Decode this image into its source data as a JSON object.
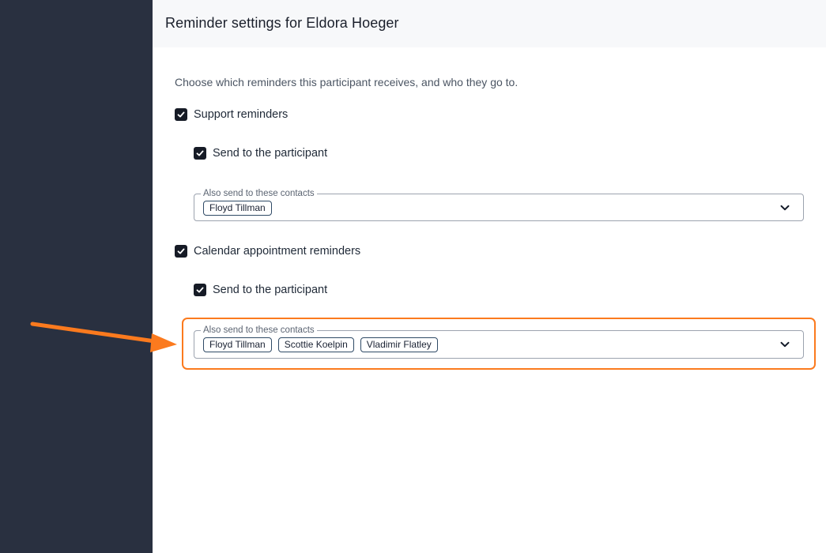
{
  "header": {
    "title": "Reminder settings for Eldora Hoeger"
  },
  "intro": "Choose which reminders this participant receives, and who they go to.",
  "sections": [
    {
      "label": "Support reminders",
      "checked": true,
      "send_to_participant": {
        "label": "Send to the participant",
        "checked": true
      },
      "contacts_field": {
        "legend": "Also send to these contacts",
        "chips": [
          "Floyd Tillman"
        ]
      }
    },
    {
      "label": "Calendar appointment reminders",
      "checked": true,
      "send_to_participant": {
        "label": "Send to the participant",
        "checked": true
      },
      "contacts_field": {
        "legend": "Also send to these contacts",
        "chips": [
          "Floyd Tillman",
          "Scottie Koelpin",
          "Vladimir Flatley"
        ]
      }
    }
  ],
  "icons": {
    "checkbox": "checkmark-icon",
    "dropdown": "chevron-down-icon",
    "annotation": "arrow-icon"
  },
  "colors": {
    "sidebar": "#293040",
    "checkbox": "#161b26",
    "highlight": "#fb7a1e",
    "chip_border": "#2f4a66"
  }
}
